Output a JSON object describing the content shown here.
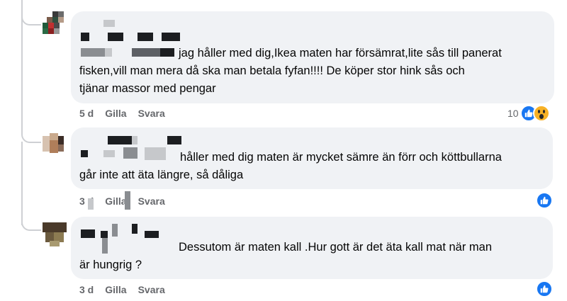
{
  "comments": [
    {
      "text_lines": [
        "jag håller med dig,Ikea maten har försämrat,lite sås till panerat",
        "fisken,vill man mera då ska man betala fyfan!!!! De köper stor hink sås och",
        "tjänar massor med pengar"
      ],
      "time": "5 d",
      "like_label": "Gilla",
      "reply_label": "Svara",
      "reaction_count": "10",
      "reactions": [
        "like-icon",
        "wow-icon"
      ]
    },
    {
      "text_lines": [
        "håller med dig maten är mycket sämre än förr och köttbullarna",
        "går inte att äta längre, så dåliga"
      ],
      "time": "3 d",
      "like_label": "Gilla",
      "reply_label": "Svara",
      "reactions": [
        "like-icon"
      ]
    },
    {
      "text_lines": [
        "Dessutom är maten kall .Hur gott är det äta kall mat när man",
        "är hungrig ?"
      ],
      "time": "3 d",
      "like_label": "Gilla",
      "reply_label": "Svara",
      "reactions": [
        "like-icon"
      ]
    }
  ],
  "colors": {
    "bubble": "#f0f2f5",
    "meta_text": "#65676b",
    "like_blue": "#1877f2",
    "wow_yellow": "#f7b125",
    "thread_line": "#ced0d4"
  }
}
